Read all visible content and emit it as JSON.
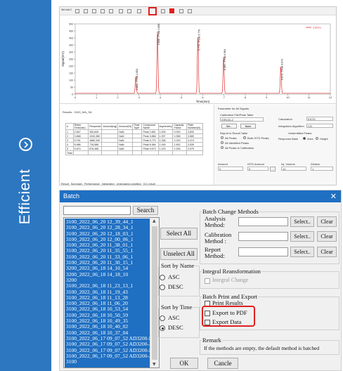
{
  "side_panel": {
    "label": "Efficient",
    "icon": "chevron-right-circle-icon",
    "color": "#2d77c0"
  },
  "chromatogram": {
    "window_title": "WrUnitLC",
    "legend": "—— 210nm",
    "x_label": "Time(min)",
    "y_label": "Signal(mV)",
    "results_title": "Results : 3100_WA_SA",
    "table_headers": [
      "#",
      "Reten. Time(min)",
      "Response",
      "Amount(mg)",
      "Amount(%)",
      "Peak Type",
      "Compound Name",
      "Asymmetry",
      "Capacity Factor",
      "Plate Number(N)"
    ],
    "table_rows": [
      [
        "1",
        "2.847",
        "350,849",
        "",
        "NaN",
        "",
        "Peak 2.851",
        "1.009",
        "0.000",
        "3,832"
      ],
      [
        "2",
        "3.868",
        "1040,380",
        "",
        "NaN",
        "",
        "Peak 3.868",
        "1.397",
        "0.358",
        "3,580"
      ],
      [
        "3",
        "5.761",
        "1880,340",
        "",
        "NaN",
        "",
        "Peak 5.770",
        "1.338",
        "1.023",
        "2,474"
      ],
      [
        "4",
        "6.986",
        "715,986",
        "",
        "NaN",
        "",
        "Peak 6.984",
        "1.169",
        "1.452",
        "2,939"
      ],
      [
        "5",
        "9.674",
        "876,485",
        "",
        "NaN",
        "",
        "Peak 9.673",
        "1.223",
        "2.393",
        "2,979"
      ]
    ],
    "total_label": "Total",
    "bottom_tabs": [
      "Result",
      "Summary",
      "Performance",
      "Integration",
      "Unknowing condition",
      "ICC result"
    ],
    "right_panel": {
      "title": "Parameter for All Signals",
      "calibration_label": "Calibration File/Peak Table",
      "calibration_value": "ISR100-2",
      "set_button": "Set...",
      "none_button": "None",
      "report_peaks_label": "Report in Result Table",
      "radio_all": "All Peaks",
      "radio_both": "Both ISTD Peaks",
      "radio_identified": "All Identified Peaks",
      "radio_calibration": "All Peaks in Calibration",
      "calculation_label": "Calculation",
      "calculation_value": "ESTD",
      "integration_label": "Integration Algorithm",
      "integration_value": "CG",
      "unidentified_label": "Unidentified Peaks",
      "response_base_label": "Response Base",
      "radio_area": "Area",
      "radio_height": "Height",
      "amount_label": "Amount",
      "istd_amount_label": "ISTD Amount",
      "inj_volume_label": "Inj. Volume",
      "dilution_label": "Dilution",
      "amount_value": "0",
      "istd_value": "0",
      "inj_value": "10",
      "dilution_value": "1"
    }
  },
  "chart_data": {
    "type": "line",
    "title": "",
    "xlabel": "Time(min)",
    "ylabel": "Signal(mV)",
    "xlim": [
      0,
      12
    ],
    "ylim": [
      0,
      500
    ],
    "x_ticks": [
      "0",
      "1",
      "2",
      "3",
      "4",
      "5",
      "6",
      "7",
      "8",
      "9",
      "10",
      "11",
      "12"
    ],
    "y_ticks": [
      "0",
      "50",
      "100",
      "150",
      "200",
      "250",
      "300",
      "350",
      "400",
      "450",
      "500"
    ],
    "series": [
      {
        "name": "210nm",
        "color": "#e03030",
        "peaks": [
          {
            "rt": 2.85,
            "height": 120,
            "label": "2.851 - Peak 2.851"
          },
          {
            "rt": 3.87,
            "height": 440,
            "label": "3.868 - Peak 3.868"
          },
          {
            "rt": 5.77,
            "height": 400,
            "label": "5.770 - Peak 5.770"
          },
          {
            "rt": 6.98,
            "height": 260,
            "label": "6.984 - Peak 6.984"
          },
          {
            "rt": 9.67,
            "height": 190,
            "label": "9.673 - Peak 9.673"
          }
        ]
      }
    ]
  },
  "batch_dialog": {
    "title": "Batch",
    "search_button": "Search",
    "search_value": "",
    "files": [
      "3100_2022_06_20 12_39_44_1",
      "3100_2022_06_20 12_28_34_1",
      "3100_2022_06_20 12_18_03_1",
      "3100_2022_06_20 12_00_06_1",
      "3100_2022_06_20 11_38_01_1",
      "3100_2022_06_20 11_35_55_1",
      "3100_2022_06_20 11_33_06_1",
      "3100_2022_06_20 11_30_15_1",
      "3200_2022_06_18 14_10_54",
      "3200_2022_06_18 14_18_10",
      "3200",
      "3100_2022_06_18 11_23_13_1",
      "3100_2022_06_18 11_19_43",
      "3100_2022_06_18 11_13_28",
      "3100_2022_06_18 11_06_20",
      "3100_2022_06_18 10_53_54",
      "3100_2022_06_18 10_50_59",
      "3100_2022_06_18 10_49_35",
      "3100_2022_06_18 10_40_02",
      "3100_2022_06_18 10_37_04",
      "3100_2022_06_17 09_07_52 AD3200-B",
      "3100_2022_06_17 09_07_52 AD3200-A",
      "3100_2022_06_17 09_07_52 AD3200-B",
      "3100_2022_06_17 09_07_52 AD3200-A",
      "3100"
    ],
    "select_all": "Select All",
    "unselect_all": "Unselect All",
    "sort_by_name": "Sort by Name",
    "sort_by_time": "Sort by Time",
    "asc": "ASC",
    "desc": "DESC",
    "batch_change_methods": "Batch Change Methods",
    "analysis_method": "Analysis Method:",
    "calibration_method": "Calibration Method :",
    "report_method": "Report Method:",
    "select_btn": "Select..",
    "clear_btn": "Clear",
    "integral_reansformation": "Integral Reansformation",
    "integral_change": "Integral Change",
    "batch_print_export": "Batch Print and Export",
    "print_results": "Print Results",
    "export_pdf": "Export to PDF",
    "export_data": "Export Data",
    "remark_title": "Remark",
    "remark_text": "If the methods are empty, the default method is batched",
    "ok": "OK",
    "cancel": "Cancle",
    "accent": "#1f6fc2",
    "highlight": "#e02020"
  }
}
